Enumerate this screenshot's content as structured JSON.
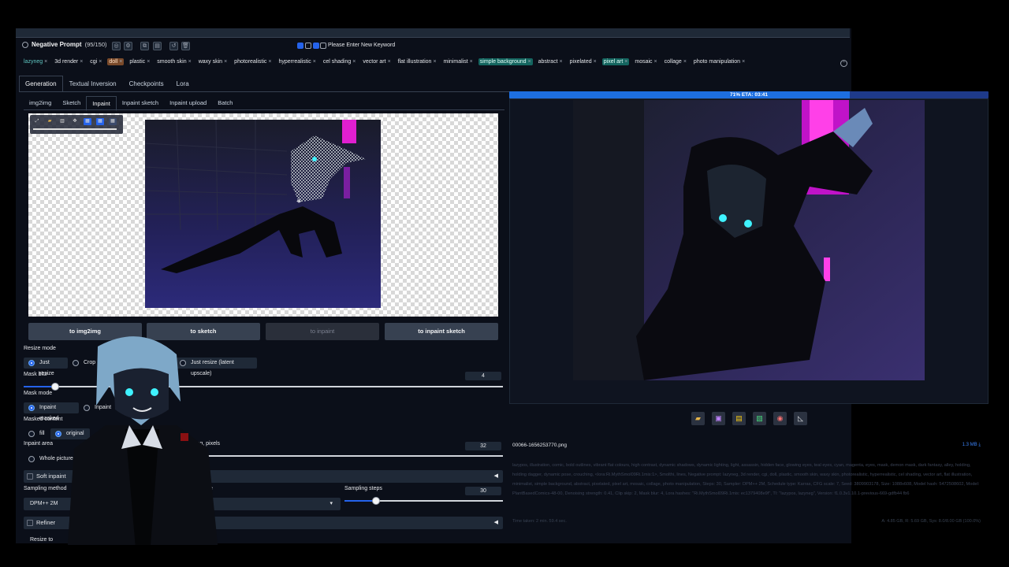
{
  "negative_prompt": {
    "title": "Negative Prompt",
    "count": "(95/150)",
    "keyword_placeholder": "Please Enter New Keyword",
    "tags": [
      {
        "label": "lazyneg",
        "style": "cyan"
      },
      {
        "label": "3d render",
        "style": ""
      },
      {
        "label": "cgi",
        "style": ""
      },
      {
        "label": "doll",
        "style": "orange"
      },
      {
        "label": "plastic",
        "style": ""
      },
      {
        "label": "smooth skin",
        "style": ""
      },
      {
        "label": "waxy skin",
        "style": ""
      },
      {
        "label": "photorealistic",
        "style": ""
      },
      {
        "label": "hyperrealistic",
        "style": ""
      },
      {
        "label": "cel shading",
        "style": ""
      },
      {
        "label": "vector art",
        "style": ""
      },
      {
        "label": "flat illustration",
        "style": ""
      },
      {
        "label": "minimalist",
        "style": ""
      },
      {
        "label": "simple background",
        "style": "teal"
      },
      {
        "label": "abstract",
        "style": ""
      },
      {
        "label": "pixelated",
        "style": ""
      },
      {
        "label": "pixel art",
        "style": "teal"
      },
      {
        "label": "mosaic",
        "style": ""
      },
      {
        "label": "collage",
        "style": ""
      },
      {
        "label": "photo manipulation",
        "style": ""
      }
    ]
  },
  "main_tabs": [
    "Generation",
    "Textual Inversion",
    "Checkpoints",
    "Lora"
  ],
  "sub_tabs": [
    "img2img",
    "Sketch",
    "Inpaint",
    "Inpaint sketch",
    "Inpaint upload",
    "Batch"
  ],
  "send_buttons": [
    "to img2img",
    "to sketch",
    "to inpaint",
    "to inpaint sketch"
  ],
  "resize_mode": {
    "label": "Resize mode",
    "selected": "Just resize",
    "options_visible": [
      "Just resize",
      "Crop",
      "Just resize (latent upscale)"
    ]
  },
  "mask_blur": {
    "label": "Mask blur",
    "value": "4",
    "fraction": 0.065
  },
  "mask_mode": {
    "label": "Mask mode",
    "selected": "Inpaint masked",
    "other": "Inpaint"
  },
  "masked_content": {
    "label": "Masked content",
    "options": [
      "fill",
      "original"
    ],
    "selected": "original"
  },
  "inpaint_area": {
    "label": "Inpaint area",
    "selected": "Whole picture",
    "padding_label": "ding, pixels",
    "padding_value": "32"
  },
  "soft_inpainting": "Soft inpaint",
  "sampling": {
    "method_label": "Sampling method",
    "method": "DPM++ 2M",
    "schedule_partial": "e",
    "steps_label": "Sampling steps",
    "steps": "30",
    "steps_fraction": 0.2
  },
  "refiner": "Refiner",
  "resize_to": "Resize to",
  "progress": {
    "text": "71% ETA: 03:41",
    "fraction": 0.71
  },
  "output": {
    "filename": "00066-1656253770.png",
    "filesize": "1.3 MB ⤓",
    "info": "lazypos, illustration, comic, bold outlines, vibrant flat colours, high contrast, dynamic shadows, dynamic lighting, light, assassin, hidden face, glowing eyes, teal eyes, cyan, magenta, eyes, mask, demon mask, dark fantasy, alley, holding, holding dagger, dynamic pose, crouching, <lora:Ri.MythSmol09Ri.1mis:1>, Smolthi, lines, Negative prompt: lazyneg, 3d render, cgi, doll, plastic, smooth skin, waxy skin, photorealistic, hyperrealistic, cel shading, vector art, flat illustration, minimalist, simple background, abstract, pixelated, pixel art, mosaic, collage, photo manipulation, Steps: 30, Sampler: DPM++ 2M, Schedule type: Karras, CFG scale: 7, Seed: 3809903178, Size: 1088x608, Model hash: 5472508602, Model: PlantBasedComics-48-00, Denoising strength: 0.41, Clip skip: 2, Mask blur: 4, Lora hashes: \"Ri.MythSmol09Ri.1mis: ec1379408e9f\", TI: \"lazypos, lazyneg\", Version: f1.0.3v1.10.1-previous-669-gdfb44 fb6",
    "time": "Time taken: 2 min. 59.4 sec.",
    "vram": "A: 4.85 GB, R: 5.69 GB, Sys: 8.0/8.00 GB (100.0%)"
  },
  "action_icons": [
    "folder-icon",
    "save-icon",
    "zip-icon",
    "image-icon",
    "palette-icon",
    "ruler-icon"
  ],
  "colors": {
    "bg": "#0b0f19",
    "panel": "#1f2937",
    "accent": "#2563eb",
    "tag_teal": "#14655f",
    "tag_orange": "#7a4a2a"
  }
}
